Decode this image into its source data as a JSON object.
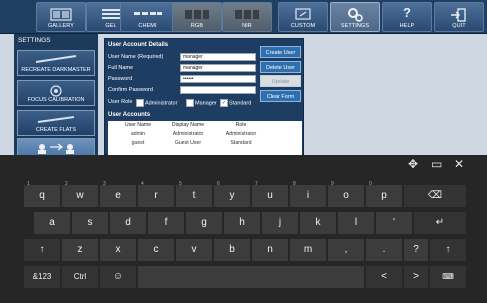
{
  "toolbar": {
    "items": [
      {
        "id": "gallery",
        "label": "GALLERY",
        "icon": "gallery-icon"
      },
      {
        "id": "gel",
        "label": "GEL",
        "icon": "gel-icon"
      },
      {
        "id": "chemi",
        "label": "CHEMI",
        "icon": "chemi-icon"
      },
      {
        "id": "rgb",
        "label": "RGB",
        "icon": "rgb-icon"
      },
      {
        "id": "nir",
        "label": "NIR",
        "icon": "nir-icon"
      },
      {
        "id": "custom",
        "label": "CUSTOM",
        "icon": "custom-icon"
      },
      {
        "id": "settings",
        "label": "SETTINGS",
        "icon": "gear-icon"
      },
      {
        "id": "help",
        "label": "HELP",
        "icon": "question-icon"
      },
      {
        "id": "quit",
        "label": "QUIT",
        "icon": "exit-icon"
      }
    ]
  },
  "sidebar": {
    "title": "SETTINGS",
    "buttons": [
      {
        "label": "RECREATE DARKMASTER"
      },
      {
        "label": "FOCUS CALIBRATION"
      },
      {
        "label": "CREATE FLATS"
      },
      {
        "label": ""
      }
    ]
  },
  "form": {
    "section_title": "User Account Details",
    "fields": [
      {
        "label": "User Name (Required)",
        "value": "manager"
      },
      {
        "label": "Full Name",
        "value": "manager"
      },
      {
        "label": "Password",
        "value": "••••••"
      },
      {
        "label": "Confirm Password",
        "value": ""
      }
    ],
    "buttons": {
      "create": "Create User",
      "delete": "Delete User",
      "update": "Update",
      "clear": "Clear Form"
    },
    "role_label": "User Role",
    "roles": [
      {
        "label": "Administrator",
        "checked": false
      },
      {
        "label": "Manager",
        "checked": false
      },
      {
        "label": "Standard",
        "checked": true
      }
    ],
    "accounts_title": "User Accounts",
    "table": {
      "headers": [
        "User Name",
        "Display Name",
        "Role"
      ],
      "rows": [
        [
          "admin",
          "Administrator",
          "Administrator"
        ],
        [
          "guest",
          "Guest User",
          "Standard"
        ]
      ]
    }
  },
  "keyboard": {
    "row1": [
      {
        "k": "q",
        "n": "1"
      },
      {
        "k": "w",
        "n": "2"
      },
      {
        "k": "e",
        "n": "3"
      },
      {
        "k": "r",
        "n": "4"
      },
      {
        "k": "t",
        "n": "5"
      },
      {
        "k": "y",
        "n": "6"
      },
      {
        "k": "u",
        "n": "7"
      },
      {
        "k": "i",
        "n": "8"
      },
      {
        "k": "o",
        "n": "9"
      },
      {
        "k": "p",
        "n": "0"
      }
    ],
    "row2": [
      "a",
      "s",
      "d",
      "f",
      "g",
      "h",
      "j",
      "k",
      "l",
      "'"
    ],
    "row3": [
      "z",
      "x",
      "c",
      "v",
      "b",
      "n",
      "m",
      ",",
      ".",
      "?"
    ],
    "backspace": "⌫",
    "enter": "↵",
    "shift": "↑",
    "sym": "&123",
    "ctrl": "Ctrl",
    "emoji": "☺",
    "left": "<",
    "right": ">",
    "kbd": "⌨",
    "move": "✥",
    "dock": "▭",
    "close": "✕"
  }
}
